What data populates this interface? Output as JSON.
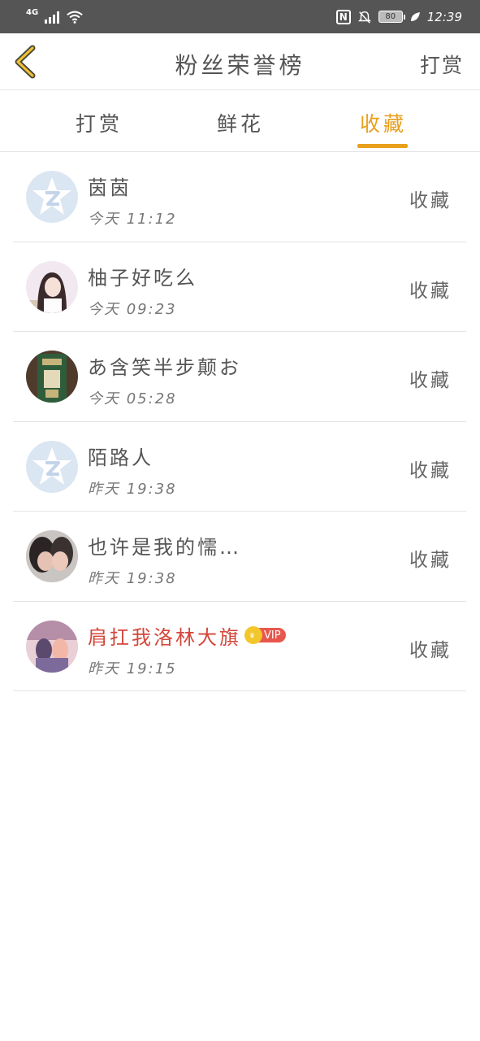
{
  "status_bar": {
    "network": "4G",
    "battery": "80",
    "time": "12:39"
  },
  "header": {
    "title": "粉丝荣誉榜",
    "action": "打赏"
  },
  "tabs": [
    {
      "label": "打赏",
      "active": false
    },
    {
      "label": "鲜花",
      "active": false
    },
    {
      "label": "收藏",
      "active": true
    }
  ],
  "colors": {
    "accent": "#e8a01d",
    "vip_name": "#d4463a",
    "status_bar_bg": "#555555"
  },
  "fans": [
    {
      "name": "茵茵",
      "time": "今天 11:12",
      "action": "收藏",
      "avatar": "default-qq-avatar"
    },
    {
      "name": "柚子好吃么",
      "time": "今天 09:23",
      "action": "收藏",
      "avatar": "photo-avatar"
    },
    {
      "name": "あ含笑半步颠お",
      "time": "今天 05:28",
      "action": "收藏",
      "avatar": "photo-avatar"
    },
    {
      "name": "陌路人",
      "time": "昨天 19:38",
      "action": "收藏",
      "avatar": "default-qq-avatar"
    },
    {
      "name": "也许是我的懦…",
      "time": "昨天 19:38",
      "action": "收藏",
      "avatar": "photo-avatar"
    },
    {
      "name": "肩扛我洛林大旗",
      "time": "昨天 19:15",
      "action": "收藏",
      "avatar": "photo-avatar",
      "vip": "VIP"
    }
  ]
}
